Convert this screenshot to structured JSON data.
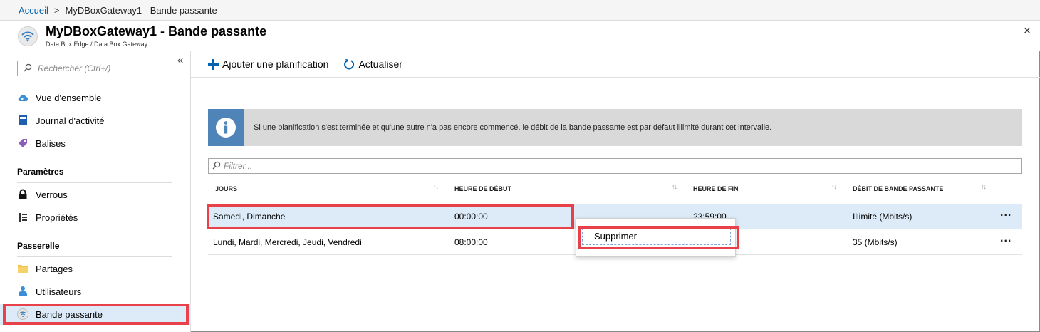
{
  "breadcrumb": {
    "home": "Accueil",
    "separator": ">",
    "current": "MyDBoxGateway1 - Bande passante"
  },
  "header": {
    "title": "MyDBoxGateway1 - Bande passante",
    "subtitle": "Data Box Edge / Data Box Gateway",
    "icon": "wifi-icon",
    "close_glyph": "×"
  },
  "sidebar": {
    "collapse_glyph": "«",
    "search_placeholder": "Rechercher (Ctrl+/)",
    "items_top": [
      {
        "label": "Vue d'ensemble",
        "icon": "cloud-icon"
      },
      {
        "label": "Journal d'activité",
        "icon": "book-icon"
      },
      {
        "label": "Balises",
        "icon": "tag-icon"
      }
    ],
    "section_params": "Paramètres",
    "items_params": [
      {
        "label": "Verrous",
        "icon": "lock-icon"
      },
      {
        "label": "Propriétés",
        "icon": "properties-icon"
      }
    ],
    "section_gateway": "Passerelle",
    "items_gateway": [
      {
        "label": "Partages",
        "icon": "folder-icon"
      },
      {
        "label": "Utilisateurs",
        "icon": "user-icon"
      },
      {
        "label": "Bande passante",
        "icon": "wifi-icon",
        "active": true
      }
    ]
  },
  "toolbar": {
    "add_label": "Ajouter une planification",
    "refresh_label": "Actualiser"
  },
  "info": {
    "text": "Si une planification s'est terminée et qu'une autre n'a pas encore commencé, le débit de la bande passante est par défaut illimité durant cet intervalle."
  },
  "filter": {
    "placeholder": "Filtrer..."
  },
  "table": {
    "headers": [
      "JOURS",
      "HEURE DE DÉBUT",
      "HEURE DE FIN",
      "DÉBIT DE BANDE PASSANTE"
    ],
    "sort_glyph": "↑↓",
    "rows": [
      {
        "days": "Samedi, Dimanche",
        "start": "00:00:00",
        "end": "23:59:00",
        "rate": "Illimité (Mbits/s)",
        "more": "...",
        "selected": true
      },
      {
        "days": "Lundi, Mardi, Mercredi, Jeudi, Vendredi",
        "start": "08:00:00",
        "end": "",
        "rate": "35 (Mbits/s)",
        "more": "..."
      }
    ]
  },
  "context_menu": {
    "delete_label": "Supprimer"
  },
  "colors": {
    "accent": "#0063b1",
    "highlight": "#e8414a",
    "selected_bg": "#dcebf7",
    "info_icon_bg": "#4f84b8"
  }
}
